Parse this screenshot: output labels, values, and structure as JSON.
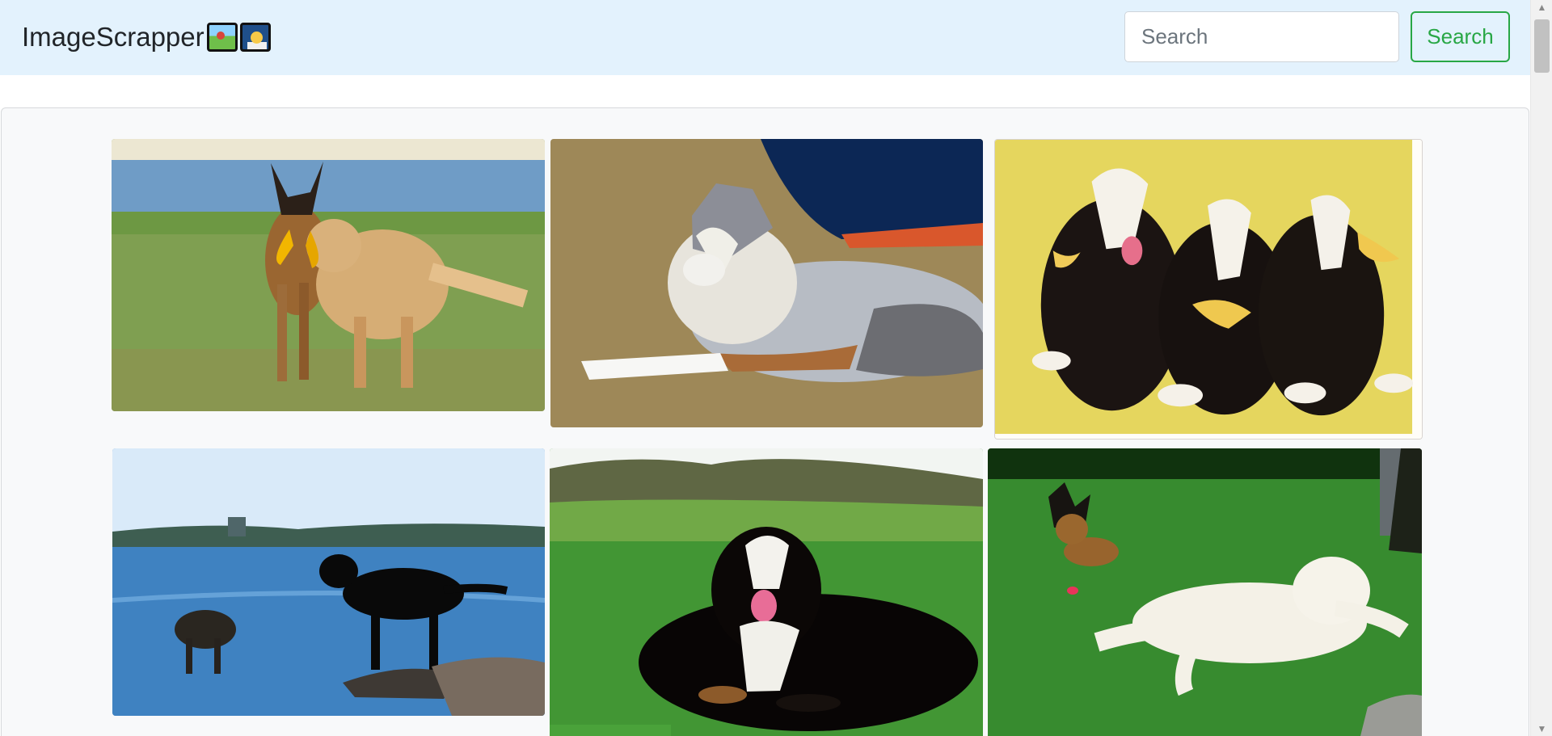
{
  "navbar": {
    "brand": "ImageScrapper",
    "brand_icons": [
      "framed-picture-icon",
      "technologist-icon"
    ],
    "search_placeholder": "Search",
    "search_value": "",
    "search_button": "Search"
  },
  "gallery": {
    "photos": [
      "german-shepherd-and-golden-retriever-playing-tug",
      "blue-merle-australian-shepherd-lying-in-grass",
      "three-bernese-mountain-puppies-with-bows",
      "two-dogs-standing-in-shallow-water",
      "bernese-mountain-dog-lying-on-lawn",
      "german-shepherd-and-golden-retriever-on-lawn"
    ]
  },
  "colors": {
    "navbar_bg": "#e3f2fd",
    "accent": "#28a745",
    "gallery_bg": "#f8f9fa"
  }
}
